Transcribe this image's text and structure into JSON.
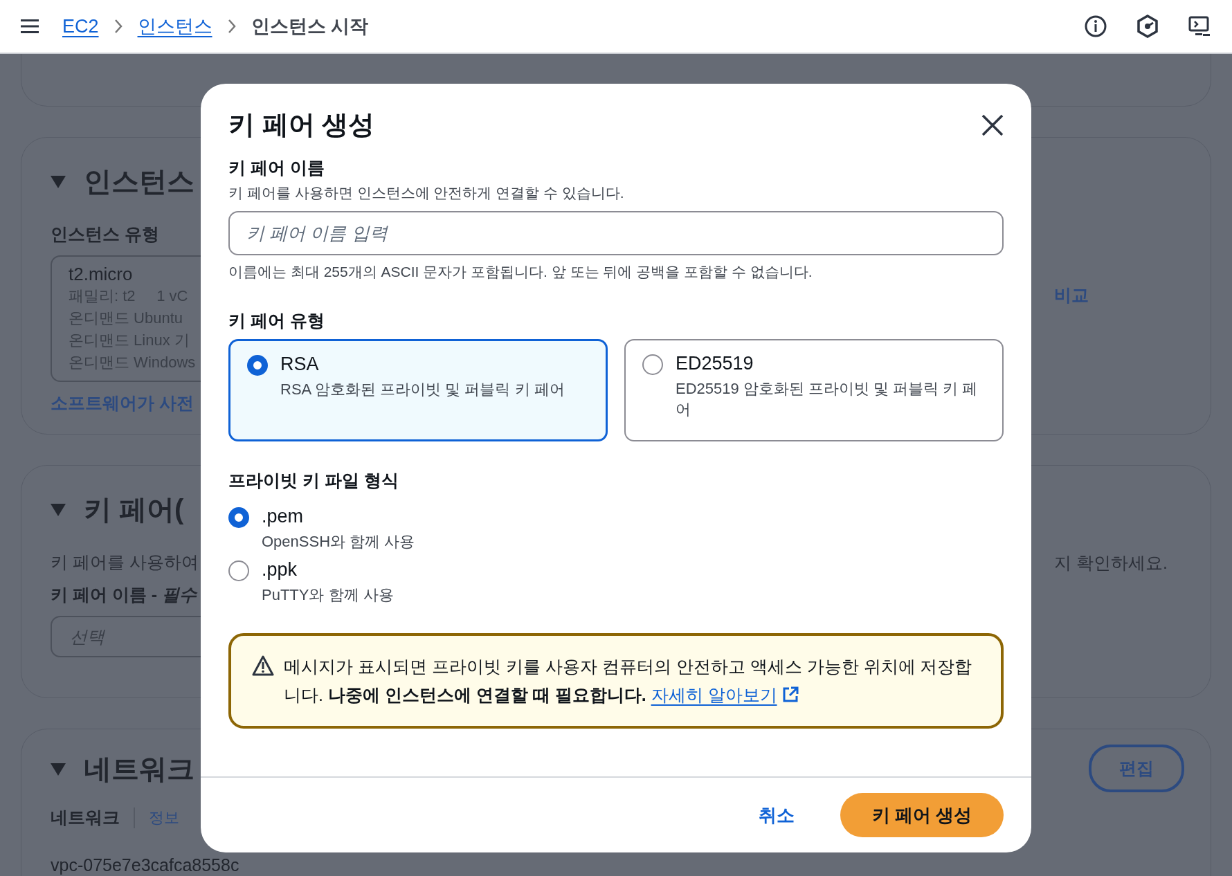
{
  "top_bar": {
    "breadcrumbs": [
      {
        "label": "EC2",
        "kind": "link"
      },
      {
        "label": "인스턴스",
        "kind": "link"
      },
      {
        "label": "인스턴스 시작",
        "kind": "current"
      }
    ]
  },
  "background": {
    "sections": [
      {
        "title": "인스턴스",
        "left": [
          {
            "kind": "label",
            "text": "인스턴스 유형"
          },
          {
            "kind": "type-card",
            "title": "t2.micro",
            "lines": [
              "패밀리: t2     1 vC",
              "온디맨드 Ubuntu",
              "온디맨드 Linux 기",
              "온디맨드 Windows"
            ]
          },
          {
            "kind": "link",
            "text": "소프트웨어가 사전"
          }
        ],
        "right": [
          {
            "kind": "link",
            "text": "비교"
          }
        ]
      },
      {
        "title": "키 페어(",
        "left": [
          {
            "kind": "text",
            "text": "키 페어를 사용하여"
          },
          {
            "kind": "label",
            "text": "키 페어 이름 - *필수*"
          },
          {
            "kind": "select",
            "text": "선택"
          }
        ],
        "right": [
          {
            "kind": "text",
            "text": "지 확인하세요."
          }
        ]
      },
      {
        "title": "네트워크",
        "left": [
          {
            "kind": "label-info",
            "text": "네트워크",
            "info": "정보"
          },
          {
            "kind": "value",
            "text": "vpc-075e7e3cafca8558c"
          }
        ],
        "right": [
          {
            "kind": "button",
            "text": "편집"
          }
        ]
      }
    ]
  },
  "modal": {
    "title": "키 페어 생성",
    "name_field": {
      "label": "키 페어 이름",
      "description": "키 페어를 사용하면 인스턴스에 안전하게 연결할 수 있습니다.",
      "placeholder": "키 페어 이름 입력",
      "constraint": "이름에는 최대 255개의 ASCII 문자가 포함됩니다. 앞 또는 뒤에 공백을 포함할 수 없습니다."
    },
    "key_type": {
      "label": "키 페어 유형",
      "options": [
        {
          "label": "RSA",
          "description": "RSA 암호화된 프라이빗 및 퍼블릭 키 페어",
          "selected": true
        },
        {
          "label": "ED25519",
          "description": "ED25519 암호화된 프라이빗 및 퍼블릭 키 페어",
          "selected": false
        }
      ]
    },
    "file_format": {
      "label": "프라이빗 키 파일 형식",
      "options": [
        {
          "label": ".pem",
          "description": "OpenSSH와 함께 사용",
          "selected": true
        },
        {
          "label": ".ppk",
          "description": "PuTTY와 함께 사용",
          "selected": false
        }
      ]
    },
    "warning": {
      "text": "메시지가 표시되면 프라이빗 키를 사용자 컴퓨터의 안전하고 액세스 가능한 위치에 저장합니다. **나중에 인스턴스에 연결할 때 필요합니다.**",
      "link": "자세히 알아보기"
    },
    "buttons": {
      "cancel": "취소",
      "create": "키 페어 생성"
    }
  }
}
